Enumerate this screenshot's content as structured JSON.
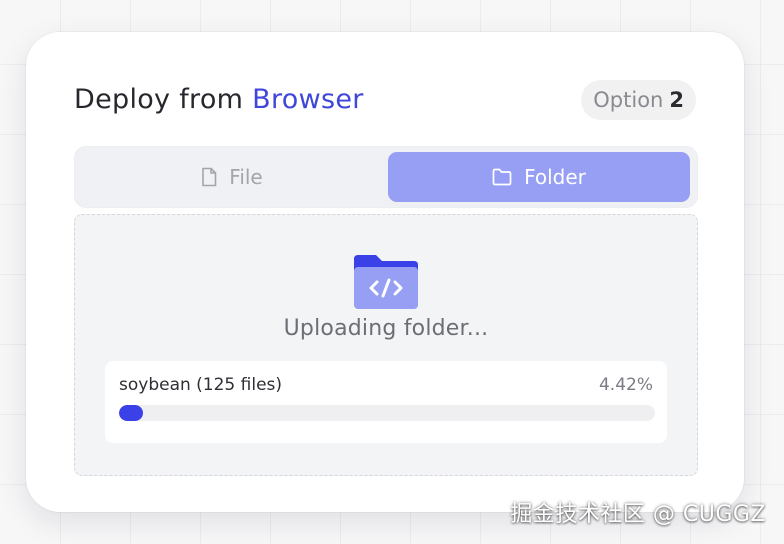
{
  "header": {
    "title_prefix": "Deploy from",
    "title_accent": "Browser",
    "option_label": "Option",
    "option_number": "2"
  },
  "tabs": [
    {
      "label": "File",
      "icon": "file-icon",
      "selected": false
    },
    {
      "label": "Folder",
      "icon": "folder-icon",
      "selected": true
    }
  ],
  "upload": {
    "status": "Uploading folder...",
    "folder_icon": "code-folder-icon",
    "file_name": "soybean (125 files)",
    "percent_text": "4.42%",
    "progress_fraction": 0.0442
  },
  "watermark": "掘金技术社区 @ CUGGZ",
  "colors": {
    "accent": "#3f46d9",
    "selected_tab": "#969ff3",
    "progress": "#3a41e6"
  }
}
